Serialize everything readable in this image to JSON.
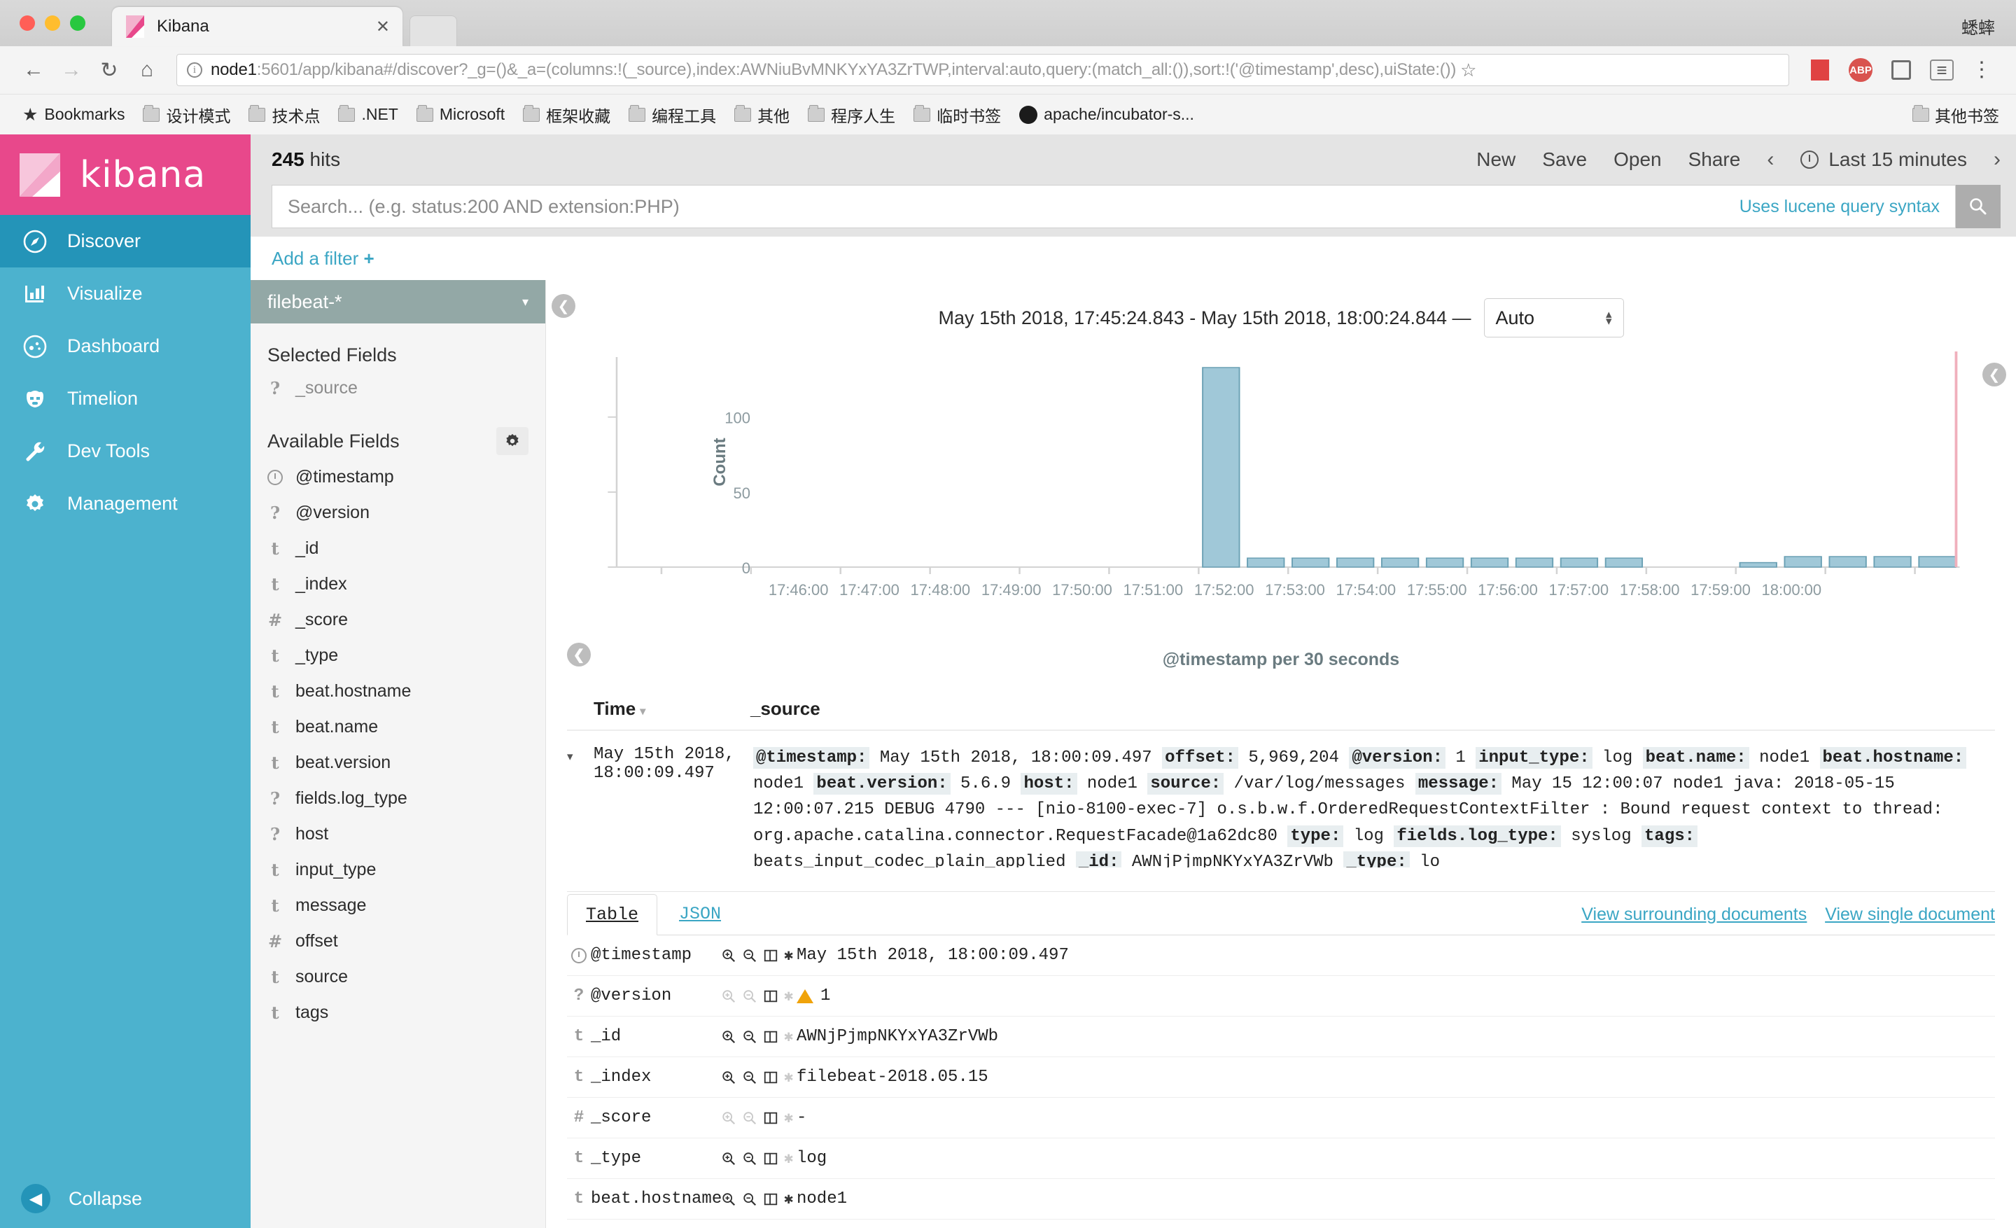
{
  "browser": {
    "tab_title": "Kibana",
    "tab_close": "✕",
    "window_user": "蟋蟀",
    "url_host": "node1",
    "url_rest": ":5601/app/kibana#/discover?_g=()&_a=(columns:!(_source),index:AWNiuBvMNKYxYA3ZrTWP,interval:auto,query:(match_all:()),sort:!('@timestamp',desc),uiState:())",
    "back_icon": "←",
    "forward_icon": "→",
    "reload_icon": "↻",
    "home_icon": "⌂",
    "star_icon": "☆",
    "abp_label": "ABP",
    "kebab_icon": "⋮",
    "bookmarks": [
      {
        "label": "Bookmarks",
        "icon": "star-icon"
      },
      {
        "label": "设计模式",
        "icon": "folder-icon"
      },
      {
        "label": "技术点",
        "icon": "folder-icon"
      },
      {
        "label": ".NET",
        "icon": "folder-icon"
      },
      {
        "label": "Microsoft",
        "icon": "folder-icon"
      },
      {
        "label": "框架收藏",
        "icon": "folder-icon"
      },
      {
        "label": "编程工具",
        "icon": "folder-icon"
      },
      {
        "label": "其他",
        "icon": "folder-icon"
      },
      {
        "label": "程序人生",
        "icon": "folder-icon"
      },
      {
        "label": "临时书签",
        "icon": "folder-icon"
      },
      {
        "label": "apache/incubator-s...",
        "icon": "github-icon"
      }
    ],
    "bookmarks_overflow": "其他书签"
  },
  "sidebar": {
    "logo_text": "kibana",
    "items": [
      {
        "label": "Discover",
        "icon": "compass-icon",
        "active": true
      },
      {
        "label": "Visualize",
        "icon": "bar-chart-icon",
        "active": false
      },
      {
        "label": "Dashboard",
        "icon": "dashboard-icon",
        "active": false
      },
      {
        "label": "Timelion",
        "icon": "timelion-icon",
        "active": false
      },
      {
        "label": "Dev Tools",
        "icon": "wrench-icon",
        "active": false
      },
      {
        "label": "Management",
        "icon": "gear-icon",
        "active": false
      }
    ],
    "collapse_label": "Collapse",
    "collapse_icon": "◀"
  },
  "header": {
    "hits_count": "245",
    "hits_label": "hits",
    "actions": [
      "New",
      "Save",
      "Open",
      "Share"
    ],
    "prev_icon": "‹",
    "next_icon": "›",
    "time_range": "Last 15 minutes"
  },
  "search": {
    "placeholder": "Search... (e.g. status:200 AND extension:PHP)",
    "value": "",
    "lucene_hint": "Uses lucene query syntax",
    "search_icon": "search-icon"
  },
  "filters": {
    "add_filter_label": "Add a filter",
    "add_filter_plus": "+"
  },
  "fields_panel": {
    "index_pattern": "filebeat-*",
    "index_caret": "▾",
    "selected_fields_title": "Selected Fields",
    "selected_fields": [
      {
        "type": "?",
        "name": "_source"
      }
    ],
    "available_fields_title": "Available Fields",
    "gear_icon": "gear-icon",
    "available_fields": [
      {
        "type": "clock",
        "name": "@timestamp"
      },
      {
        "type": "?",
        "name": "@version"
      },
      {
        "type": "t",
        "name": "_id"
      },
      {
        "type": "t",
        "name": "_index"
      },
      {
        "type": "#",
        "name": "_score"
      },
      {
        "type": "t",
        "name": "_type"
      },
      {
        "type": "t",
        "name": "beat.hostname"
      },
      {
        "type": "t",
        "name": "beat.name"
      },
      {
        "type": "t",
        "name": "beat.version"
      },
      {
        "type": "?",
        "name": "fields.log_type"
      },
      {
        "type": "?",
        "name": "host"
      },
      {
        "type": "t",
        "name": "input_type"
      },
      {
        "type": "t",
        "name": "message"
      },
      {
        "type": "#",
        "name": "offset"
      },
      {
        "type": "t",
        "name": "source"
      },
      {
        "type": "t",
        "name": "tags"
      }
    ]
  },
  "chart_data": {
    "type": "bar",
    "title": "May 15th 2018, 17:45:24.843 - May 15th 2018, 18:00:24.844",
    "interval_label": "Auto",
    "xlabel": "@timestamp per 30 seconds",
    "ylabel": "Count",
    "ylim": [
      0,
      140
    ],
    "yticks": [
      0,
      50,
      100
    ],
    "xticks": [
      "17:46:00",
      "17:47:00",
      "17:48:00",
      "17:49:00",
      "17:50:00",
      "17:51:00",
      "17:52:00",
      "17:53:00",
      "17:54:00",
      "17:55:00",
      "17:56:00",
      "17:57:00",
      "17:58:00",
      "17:59:00",
      "18:00:00"
    ],
    "grid": false,
    "bar_color": "#a0c8d8",
    "bar_border": "#6aa0b4",
    "marker_color": "#f0b0bc",
    "categories": [
      "17:45:30",
      "17:46:00",
      "17:46:30",
      "17:47:00",
      "17:47:30",
      "17:48:00",
      "17:48:30",
      "17:49:00",
      "17:49:30",
      "17:50:00",
      "17:50:30",
      "17:51:00",
      "17:51:30",
      "17:52:00",
      "17:52:30",
      "17:53:00",
      "17:53:30",
      "17:54:00",
      "17:54:30",
      "17:55:00",
      "17:55:30",
      "17:56:00",
      "17:56:30",
      "17:57:00",
      "17:57:30",
      "17:58:00",
      "17:58:30",
      "17:59:00",
      "17:59:30",
      "18:00:00"
    ],
    "values": [
      0,
      0,
      0,
      0,
      0,
      0,
      0,
      0,
      0,
      0,
      0,
      0,
      0,
      133,
      6,
      6,
      6,
      6,
      6,
      6,
      6,
      6,
      6,
      0,
      0,
      3,
      7,
      7,
      7,
      7
    ]
  },
  "doc_table": {
    "columns": [
      "Time",
      "_source"
    ],
    "sort_caret": "▾",
    "rows": [
      {
        "expand_icon": "▾",
        "time": "May 15th 2018, 18:00:09.497",
        "source_pairs": [
          {
            "key": "@timestamp:",
            "val": "May 15th 2018, 18:00:09.497"
          },
          {
            "key": "offset:",
            "val": "5,969,204"
          },
          {
            "key": "@version:",
            "val": "1"
          },
          {
            "key": "input_type:",
            "val": "log"
          },
          {
            "key": "beat.name:",
            "val": "node1"
          },
          {
            "key": "beat.hostname:",
            "val": "node1"
          },
          {
            "key": "beat.version:",
            "val": "5.6.9"
          },
          {
            "key": "host:",
            "val": "node1"
          },
          {
            "key": "source:",
            "val": "/var/log/messages"
          },
          {
            "key": "message:",
            "val": "May 15 12:00:07 node1 java: 2018-05-15 12:00:07.215 DEBUG 4790 --- [nio-8100-exec-7] o.s.b.w.f.OrderedRequestContextFilter : Bound request context to thread: org.apache.catalina.connector.RequestFacade@1a62dc80"
          },
          {
            "key": "type:",
            "val": "log"
          },
          {
            "key": "fields.log_type:",
            "val": "syslog"
          },
          {
            "key": "tags:",
            "val": "beats_input_codec_plain_applied"
          },
          {
            "key": "_id:",
            "val": "AWNjPjmpNKYxYA3ZrVWb"
          },
          {
            "key": "_type:",
            "val": "lo"
          }
        ]
      }
    ]
  },
  "detail": {
    "tabs": [
      {
        "label": "Table",
        "active": true
      },
      {
        "label": "JSON",
        "active": false
      }
    ],
    "links": [
      "View surrounding documents",
      "View single document"
    ],
    "rows": [
      {
        "type": "clock",
        "name": "@timestamp",
        "value": "May 15th 2018, 18:00:09.497",
        "muted": false,
        "star_muted": false,
        "warn": false
      },
      {
        "type": "?",
        "name": "@version",
        "value": "1",
        "muted": true,
        "star_muted": false,
        "warn": true
      },
      {
        "type": "t",
        "name": "_id",
        "value": "AWNjPjmpNKYxYA3ZrVWb",
        "muted": false,
        "star_muted": true,
        "warn": false
      },
      {
        "type": "t",
        "name": "_index",
        "value": "filebeat-2018.05.15",
        "muted": false,
        "star_muted": true,
        "warn": false
      },
      {
        "type": "#",
        "name": "_score",
        "value": "-",
        "muted": true,
        "star_muted": true,
        "warn": false
      },
      {
        "type": "t",
        "name": "_type",
        "value": "log",
        "muted": false,
        "star_muted": true,
        "warn": false
      },
      {
        "type": "t",
        "name": "beat.hostname",
        "value": "node1",
        "muted": false,
        "star_muted": false,
        "warn": false
      }
    ],
    "action_icons": [
      "zoom-in-icon",
      "zoom-out-icon",
      "toggle-column-icon",
      "filter-exists-icon"
    ]
  },
  "colors": {
    "kibana_pink": "#e8488b",
    "kibana_blue": "#4cb2ce",
    "kibana_blue_active": "#2494b8",
    "link": "#3ba6c4",
    "bar": "#a0c8d8"
  }
}
